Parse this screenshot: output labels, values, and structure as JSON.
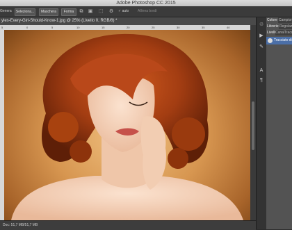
{
  "app": {
    "title": "Adobe Photoshop CC 2015"
  },
  "options_bar": {
    "mode_label": "Genera",
    "select_label": "Seleziona...",
    "mask_label": "Maschera",
    "shape_label": "Forma",
    "auto_label": "✓ auto",
    "align_label": "Allinea bordi"
  },
  "document": {
    "tab_label": "yles-Every-Girl-Should-Know-1.jpg @ 25% (Livello 0, RGB/8) *"
  },
  "ruler": {
    "ticks": [
      "5",
      "0",
      "5",
      "10",
      "15",
      "20",
      "25",
      "30",
      "35",
      "40"
    ]
  },
  "status": {
    "doc_info": "Doc: 51,7 MB/51,7 MB"
  },
  "panels": {
    "row1": [
      "Colore",
      "Campioni"
    ],
    "row2": [
      "Librerie",
      "Regolazioni"
    ],
    "row3": [
      "Livelli",
      "Canali",
      "Tracciati"
    ],
    "layer_name": "Tracciato di lavoro"
  },
  "tools": [
    "history-brush-icon",
    "play-icon",
    "brush-settings-icon",
    "text-tool-icon",
    "paragraph-icon"
  ],
  "colors": {
    "accent": "#4b6fa8",
    "hair": "#a33d12",
    "background": "#d79650"
  }
}
